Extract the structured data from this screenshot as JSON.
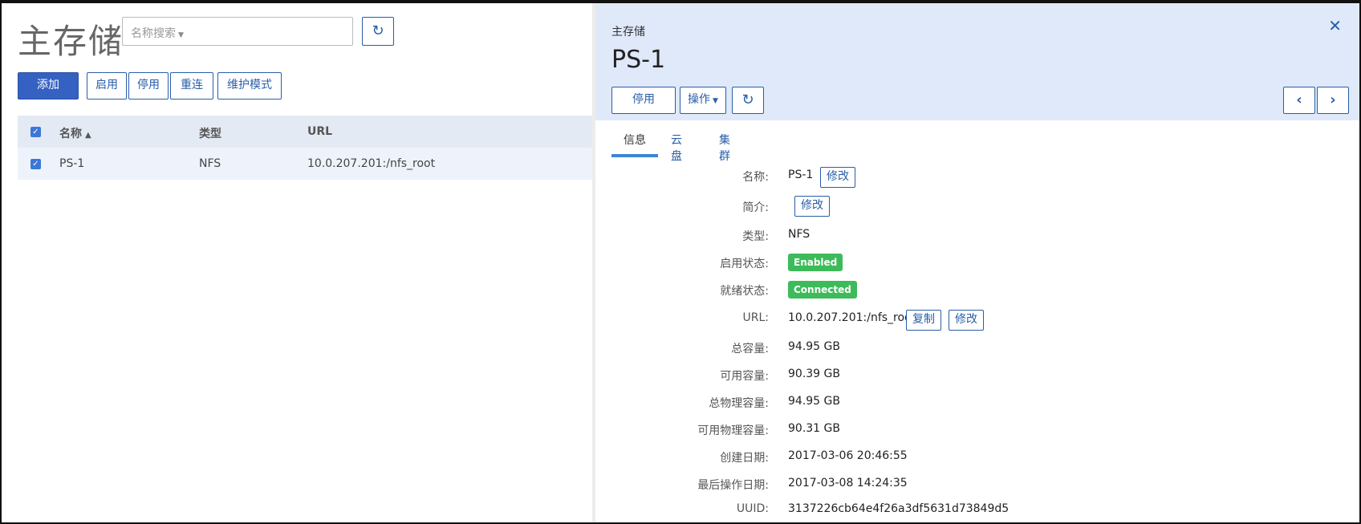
{
  "list": {
    "title": "主存储",
    "search": {
      "placeholder": "名称搜索"
    },
    "actions": {
      "add": "添加",
      "enable": "启用",
      "disable": "停用",
      "reconnect": "重连",
      "maintenance": "维护模式"
    },
    "columns": {
      "name": "名称",
      "type": "类型",
      "url": "URL"
    },
    "rows": [
      {
        "name": "PS-1",
        "type": "NFS",
        "url": "10.0.207.201:/nfs_root"
      }
    ]
  },
  "detail": {
    "breadcrumb": "主存储",
    "title": "PS-1",
    "buttons": {
      "disable": "停用",
      "actions": "操作"
    },
    "tabs": [
      "信息",
      "云盘",
      "集群"
    ],
    "edit_label": "修改",
    "copy_label": "复制",
    "fields": {
      "name": {
        "label": "名称:",
        "value": "PS-1"
      },
      "description": {
        "label": "简介:"
      },
      "type": {
        "label": "类型:",
        "value": "NFS"
      },
      "state": {
        "label": "启用状态:",
        "value": "Enabled"
      },
      "status": {
        "label": "就绪状态:",
        "value": "Connected"
      },
      "url": {
        "label": "URL:",
        "value": "10.0.207.201:/nfs_root"
      },
      "total_capacity": {
        "label": "总容量:",
        "value": "94.95 GB"
      },
      "available_capacity": {
        "label": "可用容量:",
        "value": "90.39 GB"
      },
      "total_physical": {
        "label": "总物理容量:",
        "value": "94.95 GB"
      },
      "available_physical": {
        "label": "可用物理容量:",
        "value": "90.31 GB"
      },
      "created": {
        "label": "创建日期:",
        "value": "2017-03-06 20:46:55"
      },
      "last_op": {
        "label": "最后操作日期:",
        "value": "2017-03-08 14:24:35"
      },
      "uuid": {
        "label": "UUID:",
        "value": "3137226cb64e4f26a3df5631d73849d5"
      }
    }
  },
  "colors": {
    "accent": "#2a5ea8",
    "primary_button": "#3561c2",
    "badge_green": "#3dbb5a",
    "header_bg": "#dfe9f9"
  },
  "icons": {
    "refresh": "refresh-icon",
    "close": "close-icon",
    "prev": "chevron-left-icon",
    "next": "chevron-right-icon"
  }
}
